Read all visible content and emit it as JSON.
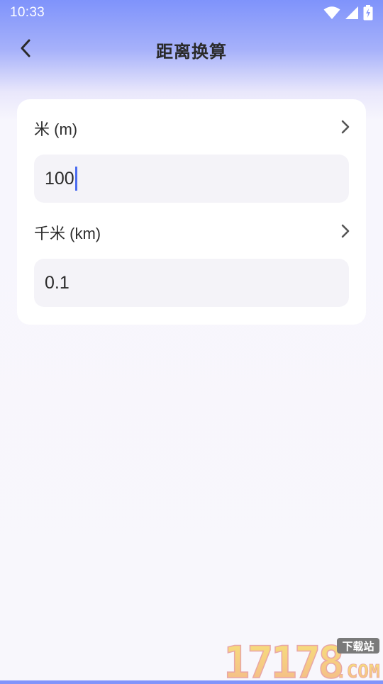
{
  "status_bar": {
    "time": "10:33",
    "icons": [
      "wifi-icon",
      "cell-signal-icon",
      "battery-charging-icon"
    ]
  },
  "header": {
    "title": "距离换算",
    "back_icon": "chevron-left-icon"
  },
  "converter": {
    "rows": [
      {
        "unit_label": "米 (m)",
        "value": "100",
        "focused": true,
        "chevron_icon": "chevron-right-icon"
      },
      {
        "unit_label": "千米 (km)",
        "value": "0.1",
        "focused": false,
        "chevron_icon": "chevron-right-icon"
      }
    ]
  },
  "watermark": {
    "brand": "17178",
    "tag": "下载站",
    "domain": ".COM"
  },
  "colors": {
    "accent": "#4b6cf0",
    "header_gradient_top": "#7f93fb",
    "background": "#f8f7fc",
    "field_background": "#f4f3f8"
  }
}
